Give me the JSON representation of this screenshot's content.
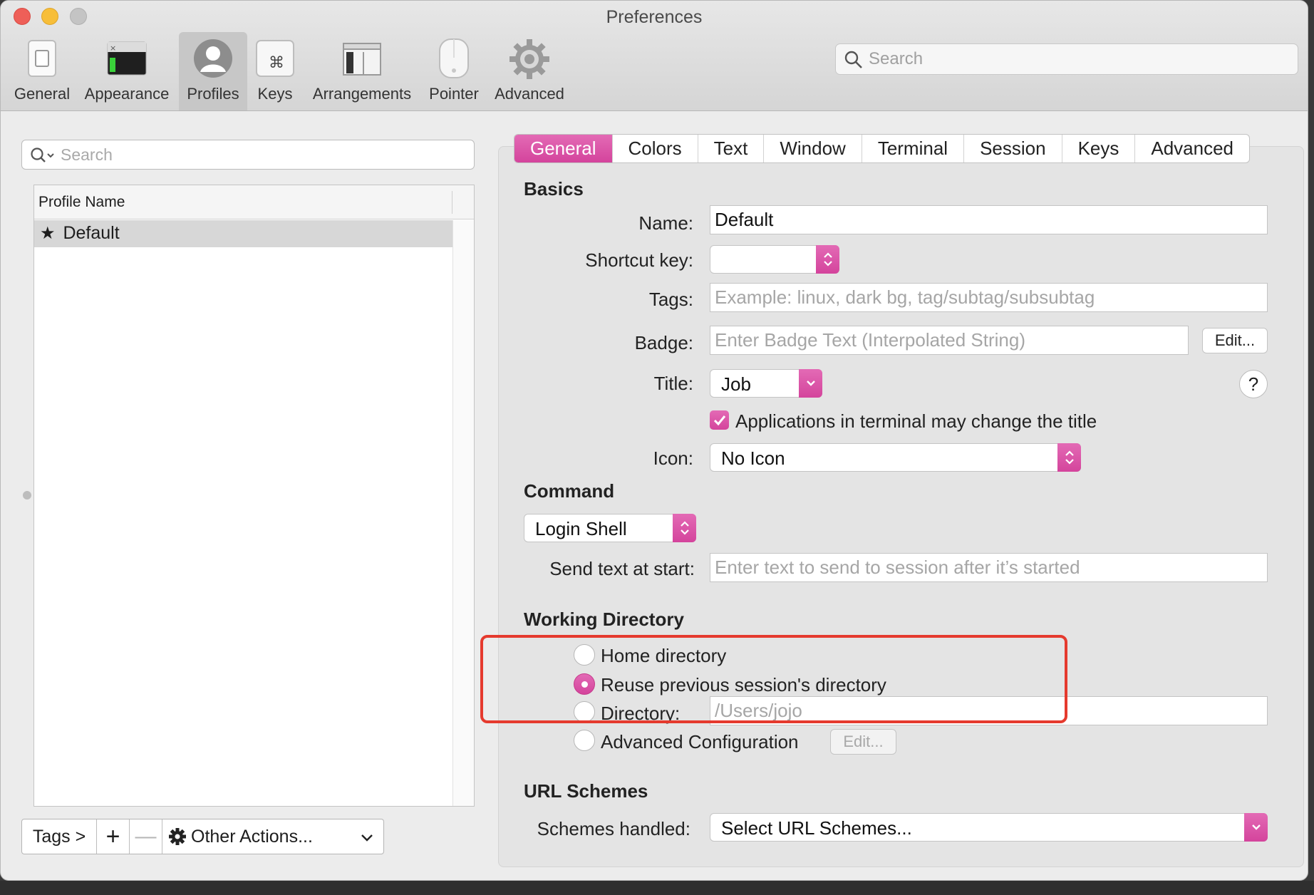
{
  "window": {
    "title": "Preferences"
  },
  "toolbar": {
    "items": [
      {
        "label": "General",
        "icon": "general-switch-icon"
      },
      {
        "label": "Appearance",
        "icon": "appearance-terminal-icon"
      },
      {
        "label": "Profiles",
        "icon": "profiles-user-icon",
        "active": true
      },
      {
        "label": "Keys",
        "icon": "keys-command-icon"
      },
      {
        "label": "Arrangements",
        "icon": "arrangements-windows-icon"
      },
      {
        "label": "Pointer",
        "icon": "pointer-mouse-icon"
      },
      {
        "label": "Advanced",
        "icon": "advanced-gear-icon"
      }
    ],
    "search_placeholder": "Search"
  },
  "left": {
    "search_placeholder": "Search",
    "column_header": "Profile Name",
    "profiles": [
      {
        "name": "Default",
        "star": "★"
      }
    ],
    "bottom": {
      "tags": "Tags >",
      "add": "+",
      "remove": "—",
      "other_actions": "Other Actions...",
      "chevron": "⌄"
    }
  },
  "tabs": [
    "General",
    "Colors",
    "Text",
    "Window",
    "Terminal",
    "Session",
    "Keys",
    "Advanced"
  ],
  "active_tab": "General",
  "basics": {
    "section": "Basics",
    "name_label": "Name:",
    "name_value": "Default",
    "shortcut_label": "Shortcut key:",
    "shortcut_value": "",
    "tags_label": "Tags:",
    "tags_placeholder": "Example: linux, dark bg, tag/subtag/subsubtag",
    "badge_label": "Badge:",
    "badge_placeholder": "Enter Badge Text (Interpolated String)",
    "badge_edit": "Edit...",
    "title_label": "Title:",
    "title_value": "Job",
    "help": "?",
    "apps_change_title": "Applications in terminal may change the title",
    "apps_change_title_checked": true,
    "icon_label": "Icon:",
    "icon_value": "No Icon"
  },
  "command": {
    "section": "Command",
    "value": "Login Shell",
    "send_text_label": "Send text at start:",
    "send_text_placeholder": "Enter text to send to session after it’s started"
  },
  "working_directory": {
    "section": "Working Directory",
    "options": [
      "Home directory",
      "Reuse previous session's directory",
      "Directory:",
      "Advanced Configuration"
    ],
    "selected": "Reuse previous session's directory",
    "directory_placeholder": "/Users/jojo",
    "advanced_edit": "Edit..."
  },
  "url_schemes": {
    "section": "URL Schemes",
    "label": "Schemes handled:",
    "value": "Select URL Schemes..."
  },
  "colors": {
    "accent": "#d94fa3",
    "highlight": "#e53a2e"
  }
}
